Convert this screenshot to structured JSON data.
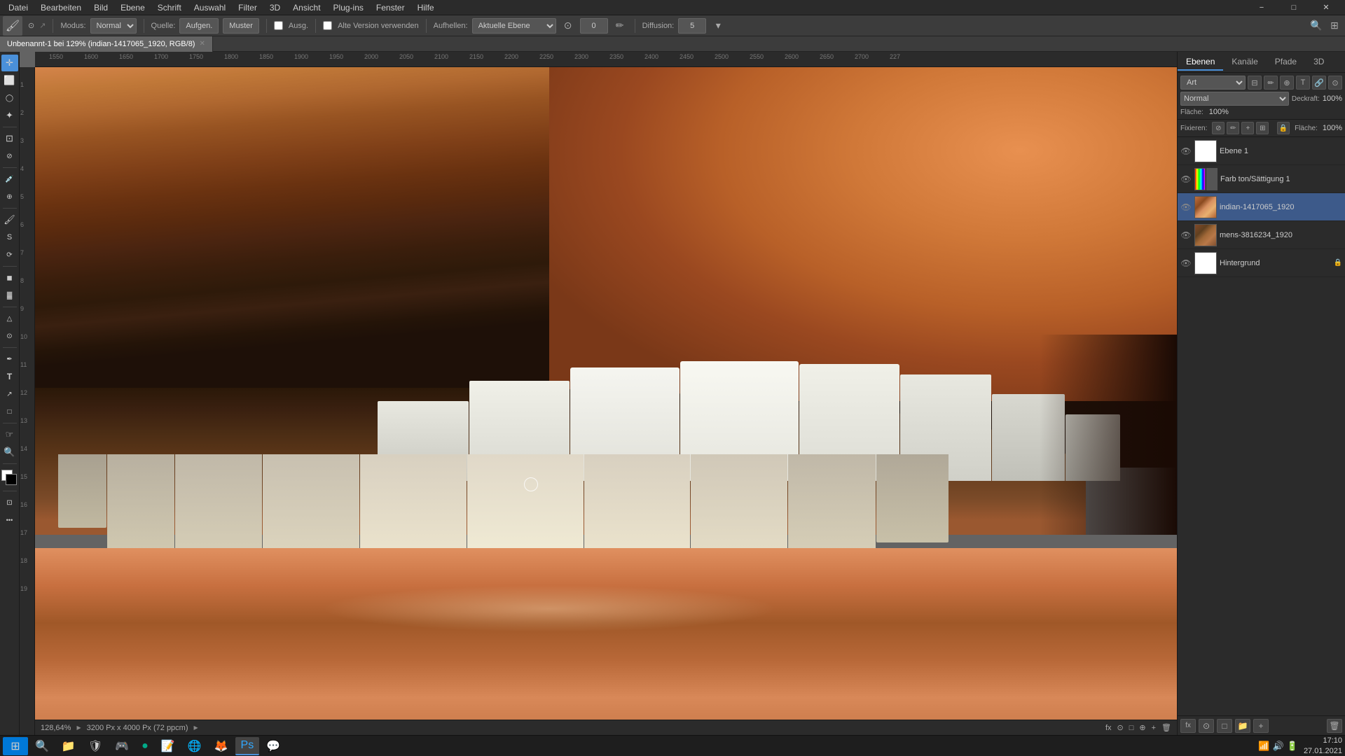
{
  "app": {
    "title": "Photoshop",
    "window_controls": {
      "minimize": "−",
      "maximize": "□",
      "close": "✕"
    }
  },
  "menubar": {
    "items": [
      "Datei",
      "Bearbeiten",
      "Bild",
      "Ebene",
      "Schrift",
      "Auswahl",
      "Filter",
      "3D",
      "Ansicht",
      "Plug-ins",
      "Fenster",
      "Hilfe"
    ]
  },
  "optionsbar": {
    "tool_icon": "🖌",
    "modus_label": "Modus:",
    "modus_value": "Normal",
    "quelle_label": "Quelle:",
    "aufgen_btn": "Aufgen.",
    "muster_btn": "Muster",
    "ausg_label": "Ausg.",
    "alte_version_label": "Alte Version verwenden",
    "aufhellen_label": "Aufhellen:",
    "aktuelle_ebene": "Aktuelle Ebene",
    "diffusion_label": "Diffusion:",
    "diffusion_value": "5"
  },
  "tab": {
    "label": "Unbenannt-1 bei 129% (indian-1417065_1920, RGB/8)",
    "close": "✕"
  },
  "canvas": {
    "zoom": "128,64%",
    "info": "3200 Px x 4000 Px (72 ppcm)",
    "date": "27.01.2021",
    "ruler_marks": [
      "1550",
      "1600",
      "1650",
      "1700",
      "1750",
      "1800",
      "1850",
      "1900",
      "1950",
      "2000",
      "2050",
      "2100",
      "2150",
      "2200",
      "2250",
      "2300",
      "2350",
      "2400",
      "2450",
      "2500",
      "2550",
      "2600",
      "2650",
      "2700",
      "227"
    ]
  },
  "layers_panel": {
    "tabs": [
      {
        "label": "Ebenen",
        "active": true
      },
      {
        "label": "Kanäle",
        "active": false
      },
      {
        "label": "Pfade",
        "active": false
      },
      {
        "label": "3D",
        "active": false
      }
    ],
    "search_placeholder": "Art",
    "blend_mode": "Normal",
    "opacity_label": "Deckraft:",
    "opacity_value": "100%",
    "fill_label": "Fläche:",
    "fill_value": "100%",
    "lock_icons": [
      "🔒",
      "⊘",
      "+",
      "🔗",
      "🔒"
    ],
    "layers": [
      {
        "name": "Ebene 1",
        "visible": true,
        "thumb_type": "white",
        "active": false,
        "locked": false
      },
      {
        "name": "Farb ton/Sättigung 1",
        "visible": true,
        "thumb_type": "hue",
        "active": false,
        "locked": false
      },
      {
        "name": "indian-1417065_1920",
        "visible": true,
        "thumb_type": "img",
        "active": true,
        "locked": false
      },
      {
        "name": "mens-3816234_1920",
        "visible": true,
        "thumb_type": "img2",
        "active": false,
        "locked": false
      },
      {
        "name": "Hintergrund",
        "visible": true,
        "thumb_type": "white",
        "active": false,
        "locked": true
      }
    ]
  },
  "toolbar": {
    "tools": [
      {
        "icon": "↕",
        "name": "move-tool"
      },
      {
        "icon": "⬜",
        "name": "marquee-tool"
      },
      {
        "icon": "🔭",
        "name": "lasso-tool"
      },
      {
        "icon": "✦",
        "name": "magic-wand-tool"
      },
      {
        "icon": "✂",
        "name": "crop-tool"
      },
      {
        "icon": "🔲",
        "name": "slice-tool"
      },
      {
        "icon": "💉",
        "name": "eyedropper-tool"
      },
      {
        "icon": "⌨",
        "name": "healing-brush-tool"
      },
      {
        "icon": "🖌",
        "name": "brush-tool"
      },
      {
        "icon": "🖊",
        "name": "pencil-tool"
      },
      {
        "icon": "S",
        "name": "clone-stamp-tool"
      },
      {
        "icon": "⟳",
        "name": "history-brush-tool"
      },
      {
        "icon": "◼",
        "name": "eraser-tool"
      },
      {
        "icon": "▓",
        "name": "gradient-tool"
      },
      {
        "icon": "⟡",
        "name": "blur-tool"
      },
      {
        "icon": "⊙",
        "name": "dodge-tool"
      },
      {
        "icon": "✏",
        "name": "pen-tool"
      },
      {
        "icon": "T",
        "name": "type-tool"
      },
      {
        "icon": "↗",
        "name": "path-selection-tool"
      },
      {
        "icon": "□",
        "name": "shape-tool"
      },
      {
        "icon": "☞",
        "name": "hand-tool"
      },
      {
        "icon": "🔍",
        "name": "zoom-tool"
      }
    ]
  },
  "taskbar": {
    "apps": [
      {
        "icon": "⊞",
        "label": "",
        "name": "start-button"
      },
      {
        "icon": "🔍",
        "label": "",
        "name": "search-button"
      },
      {
        "icon": "📁",
        "label": "",
        "name": "file-explorer"
      },
      {
        "icon": "🛡",
        "label": "",
        "name": "security-app"
      },
      {
        "icon": "🎮",
        "label": "",
        "name": "game-bar"
      },
      {
        "icon": "🟢",
        "label": "",
        "name": "xbox-app"
      },
      {
        "icon": "📒",
        "label": "",
        "name": "notes-app"
      },
      {
        "icon": "🌐",
        "label": "",
        "name": "browser-app"
      },
      {
        "icon": "🦊",
        "label": "",
        "name": "firefox-app"
      },
      {
        "icon": "🔵",
        "label": "",
        "name": "ps-app"
      },
      {
        "icon": "💬",
        "label": "",
        "name": "teams-app"
      }
    ],
    "time": "17:10",
    "date": "27.01.2021"
  }
}
